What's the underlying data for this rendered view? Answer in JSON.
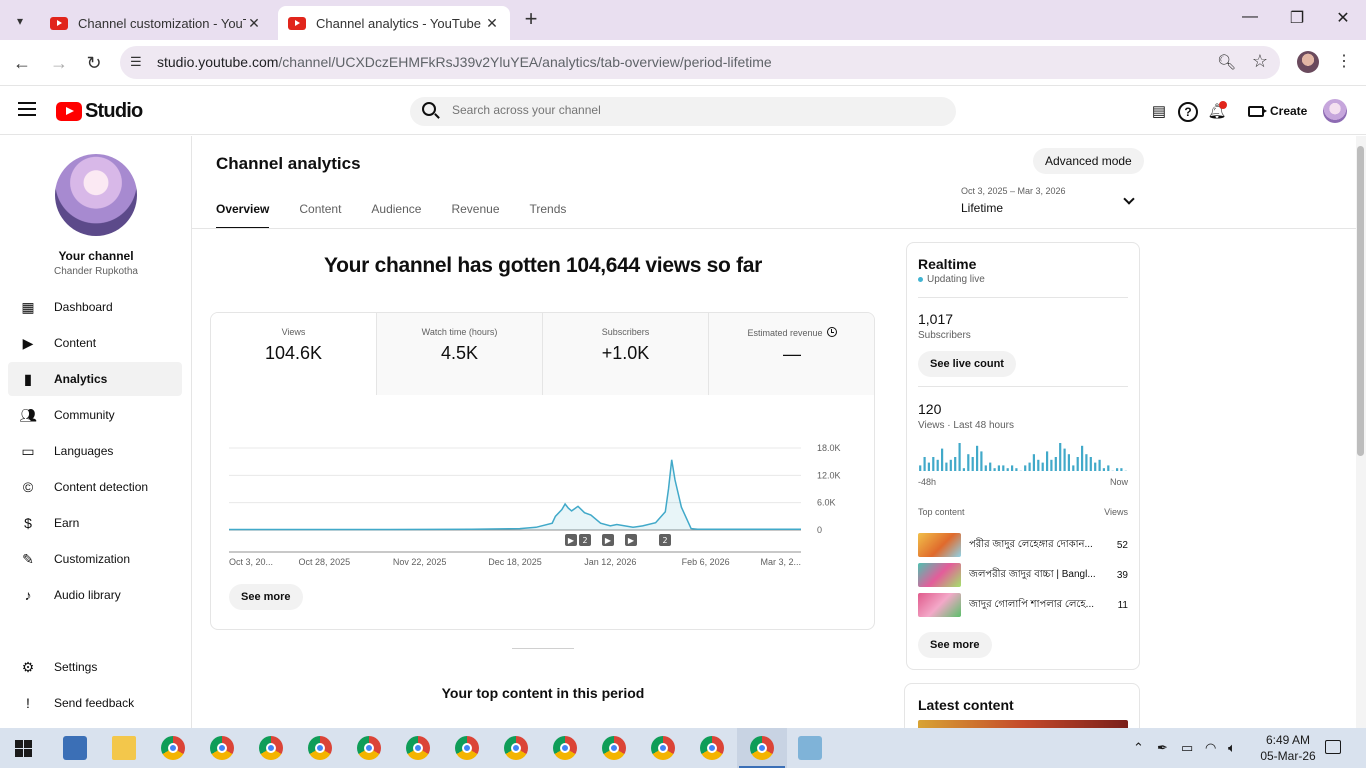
{
  "browser": {
    "tabs": [
      {
        "title": "Channel customization - YouTube Studio",
        "active": false
      },
      {
        "title": "Channel analytics - YouTube Studio",
        "active": true
      }
    ],
    "url_host": "studio.youtube.com",
    "url_path": "/channel/UCXDczEHMFkRsJ39v2YluYEA/analytics/tab-overview/period-lifetime",
    "new_tab_label": "+",
    "minimize_label": "—",
    "maximize_label": "❐",
    "close_label": "✕"
  },
  "header": {
    "logo_text": "Studio",
    "search_placeholder": "Search across your channel",
    "create_label": "Create"
  },
  "sidebar": {
    "your_channel_label": "Your channel",
    "channel_name": "Chander Rupkotha",
    "items": [
      {
        "label": "Dashboard",
        "icon": "dashboard-icon"
      },
      {
        "label": "Content",
        "icon": "content-icon"
      },
      {
        "label": "Analytics",
        "icon": "analytics-icon",
        "active": true
      },
      {
        "label": "Community",
        "icon": "community-icon"
      },
      {
        "label": "Languages",
        "icon": "languages-icon"
      },
      {
        "label": "Content detection",
        "icon": "copyright-icon"
      },
      {
        "label": "Earn",
        "icon": "dollar-icon"
      },
      {
        "label": "Customization",
        "icon": "magic-wand-icon"
      },
      {
        "label": "Audio library",
        "icon": "audio-library-icon"
      }
    ],
    "settings_label": "Settings",
    "feedback_label": "Send feedback"
  },
  "analytics": {
    "page_title": "Channel analytics",
    "advanced_mode_label": "Advanced mode",
    "tabs": [
      "Overview",
      "Content",
      "Audience",
      "Revenue",
      "Trends"
    ],
    "date_range": "Oct 3, 2025 – Mar 3, 2026",
    "period": "Lifetime",
    "headline": "Your channel has gotten 104,644 views so far",
    "metrics": [
      {
        "label": "Views",
        "value": "104.6K"
      },
      {
        "label": "Watch time (hours)",
        "value": "4.5K"
      },
      {
        "label": "Subscribers",
        "value": "+1.0K"
      },
      {
        "label": "Estimated revenue",
        "value": "—"
      }
    ],
    "see_more_label": "See more",
    "top_content_title": "Your top content in this period",
    "video_markers": [
      "▶",
      "2",
      "▶",
      "▶",
      "2"
    ]
  },
  "chart_data": {
    "type": "area",
    "title": "",
    "ylabel": "Views",
    "x_tick_labels": [
      "Oct 3, 20...",
      "Oct 28, 2025",
      "Nov 22, 2025",
      "Dec 18, 2025",
      "Jan 12, 2026",
      "Feb 6, 2026",
      "Mar 3, 2..."
    ],
    "y_tick_labels": [
      "18.0K",
      "12.0K",
      "6.0K",
      "0"
    ],
    "ylim": [
      0,
      18000
    ],
    "x_day_index": [
      0,
      25,
      50,
      75,
      90,
      95,
      100,
      101,
      103,
      104,
      105,
      106,
      107,
      108,
      110,
      112,
      115,
      118,
      120,
      125,
      128,
      132,
      135,
      136,
      137,
      138,
      140,
      143,
      145,
      150,
      155,
      160,
      165,
      170,
      177
    ],
    "values": [
      100,
      120,
      120,
      150,
      300,
      600,
      1500,
      3000,
      4500,
      5700,
      4800,
      4200,
      4700,
      5200,
      3800,
      3300,
      1500,
      900,
      1200,
      600,
      900,
      1600,
      4000,
      9000,
      15400,
      11000,
      5000,
      300,
      150,
      150,
      150,
      150,
      150,
      150,
      150
    ],
    "grid": true,
    "color": "#41a9c9"
  },
  "realtime": {
    "title": "Realtime",
    "live_label": "Updating live",
    "subscribers_value": "1,017",
    "subscribers_label": "Subscribers",
    "see_live_count_label": "See live count",
    "views_value": "120",
    "views_label": "Views · Last 48 hours",
    "axis_start": "-48h",
    "axis_end": "Now",
    "hourly_views": [
      2,
      5,
      3,
      5,
      4,
      8,
      3,
      4,
      5,
      10,
      1,
      6,
      5,
      9,
      7,
      2,
      3,
      1,
      2,
      2,
      1,
      2,
      1,
      0,
      2,
      3,
      6,
      4,
      3,
      7,
      4,
      5,
      10,
      8,
      6,
      2,
      5,
      9,
      6,
      5,
      3,
      4,
      1,
      2,
      0,
      1,
      1,
      0
    ],
    "top_content_label": "Top content",
    "views_column_label": "Views",
    "top_content": [
      {
        "title": "পরীর জাদুর লেহেঙ্গার দোকান...",
        "views": "52",
        "thumb_color": "#e7a43a"
      },
      {
        "title": "জলপরীর জাদুর বাচ্চা | Bangl...",
        "views": "39",
        "thumb_color": "#3bb3a3"
      },
      {
        "title": "জাদুর গোলাপি শাপলার লেহে...",
        "views": "11",
        "thumb_color": "#d05a8a"
      }
    ],
    "see_more_label": "See more"
  },
  "latest_content": {
    "title": "Latest content"
  },
  "taskbar": {
    "time": "6:49 AM",
    "date": "05-Mar-26"
  },
  "colors": {
    "brand_red": "#ff0000",
    "chart_line": "#41a9c9",
    "live_dot": "#41b4d2"
  }
}
